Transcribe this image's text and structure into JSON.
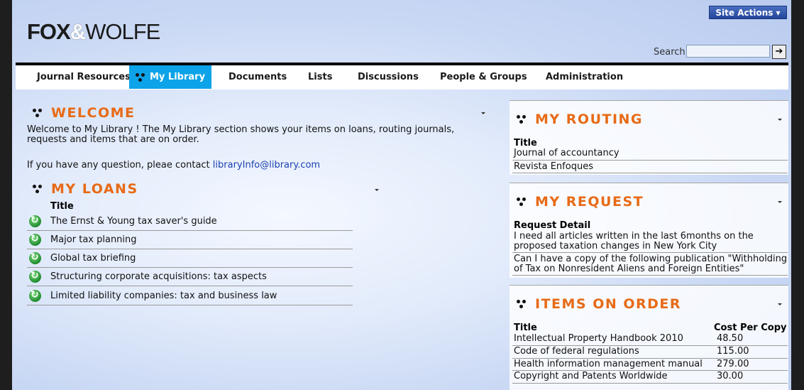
{
  "header": {
    "site_actions": "Site Actions ▾",
    "logo_fox": "FOX",
    "logo_amp": "&",
    "logo_wolfe": "WOLFE",
    "search_label": "Search",
    "search_value": "",
    "search_go": "➔"
  },
  "nav": {
    "items": [
      {
        "label": "Journal Resources"
      },
      {
        "label": "My Library",
        "active": true
      },
      {
        "label": "Documents"
      },
      {
        "label": "Lists"
      },
      {
        "label": "Discussions"
      },
      {
        "label": "People & Groups"
      },
      {
        "label": "Administration"
      }
    ]
  },
  "welcome": {
    "title": "WELCOME",
    "text": "Welcome to My Library ! The My Library section shows your items on loans, routing journals, requests and items that are on order.",
    "contact_prefix": "If you have any question, pleae contact ",
    "contact_email": "libraryInfo@library.com"
  },
  "loans": {
    "title": "MY LOANS",
    "column": "Title",
    "items": [
      "The Ernst & Young tax saver's guide",
      "Major tax planning",
      "Global tax briefing",
      "Structuring corporate acquisitions: tax aspects",
      "Limited liability companies: tax and business law"
    ]
  },
  "routing": {
    "title": "MY ROUTING",
    "column": "Title",
    "items": [
      "Journal of accountancy",
      "Revista Enfoques"
    ]
  },
  "request": {
    "title": "MY REQUEST",
    "column": "Request Detail",
    "items": [
      "I need all articles written in the last 6months on the proposed taxation changes in New York City",
      "Can I have a copy of the following publication \"Withholding of Tax on Nonresident Aliens and Foreign Entities\""
    ]
  },
  "order": {
    "title": "ITEMS ON ORDER",
    "col_title": "Title",
    "col_cost": "Cost Per Copy",
    "items": [
      {
        "title": "Intellectual Property Handbook 2010",
        "cost": "48.50"
      },
      {
        "title": "Code of federal regulations",
        "cost": "115.00"
      },
      {
        "title": "Health information management manual",
        "cost": "279.00"
      },
      {
        "title": "Copyright and Patents Worldwide",
        "cost": "30.00"
      }
    ]
  },
  "colors": {
    "accent": "#e86a16",
    "nav_active": "#0ca3e8",
    "link": "#1a3fb0"
  }
}
